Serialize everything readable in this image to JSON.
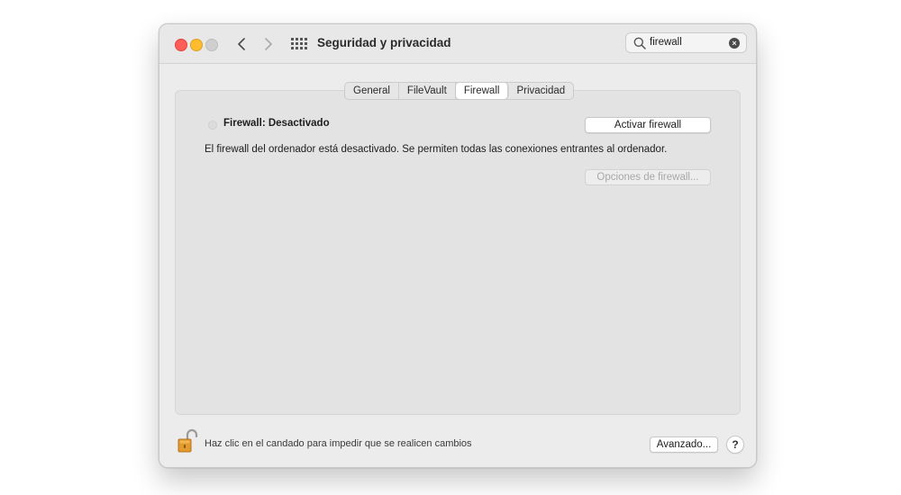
{
  "window": {
    "title": "Seguridad y privacidad"
  },
  "toolbar": {
    "traffic_lights": [
      "close",
      "minimize",
      "zoom"
    ],
    "back_icon": "chevron-left-icon",
    "forward_icon": "chevron-right-icon",
    "grid_icon": "show-all-grid-icon"
  },
  "search": {
    "value": "firewall",
    "icon": "magnifier-icon",
    "clear_icon": "clear-icon",
    "clear_glyph": "×"
  },
  "tabs": [
    {
      "label": "General",
      "active": false
    },
    {
      "label": "FileVault",
      "active": false
    },
    {
      "label": "Firewall",
      "active": true
    },
    {
      "label": "Privacidad",
      "active": false
    }
  ],
  "firewall": {
    "status_label": "Firewall: Desactivado",
    "description": "El firewall del ordenador está desactivado. Se permiten todas las conexiones entrantes al ordenador.",
    "activate_button": "Activar firewall",
    "options_button": "Opciones de firewall..."
  },
  "footer": {
    "lock_icon": "unlocked-padlock-icon",
    "lock_text": "Haz clic en el candado para impedir que se realicen cambios",
    "advanced_button": "Avanzado...",
    "help_button": "?"
  },
  "colors": {
    "close": "#ff5f57",
    "minimize": "#febc2e",
    "zoom_inactive": "#cfcfcf",
    "window_bg": "#ececec",
    "panel_bg": "#e3e3e3"
  }
}
